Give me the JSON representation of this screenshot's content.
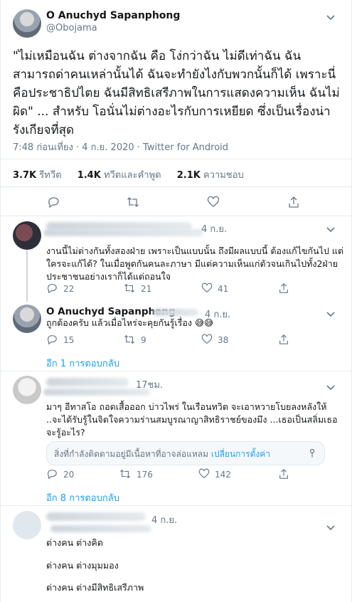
{
  "tweet": {
    "author_name": "O Anuchyd Sapanphong",
    "author_handle": "@Obojama",
    "text": "\"ไม่เหมือนฉัน ต่างจากฉัน คือ โง่กว่าฉัน ไม่ดีเท่าฉัน ฉันสามารถด่าคนเหล่านั้นได้ ฉันจะทำยังไงกับพวกนั้นก็ได้ เพราะนี่คือประชาธิปไตย ฉันมีสิทธิเสรีภาพในการแสดงความเห็น ฉันไม่ผิด\" ... สำหรับ โอนั่นไม่ต่างอะไรกับการเหยียด ซึ่งเป็นเรื่องน่ารังเกียจที่สุด",
    "meta": "7:48 ก่อนเที่ยง · 4 ก.ย. 2020 · Twitter for Android",
    "stats": {
      "retweets_value": "3.7K",
      "retweets_label": "รีทวีต",
      "quotes_value": "1.4K",
      "quotes_label": "ทวีตและคำพูด",
      "likes_value": "2.1K",
      "likes_label": "ความชอบ"
    }
  },
  "replies": [
    {
      "time": "4 ก.ย.",
      "text": "งานนี้ไม่ต่างกันทั้งสองฝ่าย เพราะเป็นแบบนั้น ถึงมีผลแบบนี้ ต้องแก้ไขกันไป แต่ใครจะแก้ได้? ในเมื่อพูดกันคนละภาษา มีแต่ความเห็นแก่ตัวจนเกินไปทั้ง2ฝ่าย ประชาชนอย่างเราก็ได้แต่ถอนใจ",
      "replies": "22",
      "retweets": "21",
      "likes": "41"
    },
    {
      "author_name": "O Anuchyd Sapanphong",
      "time": "4 ก.ย.",
      "text": "ถูกต้องครับ แล้วเมื่อไหร่จะคุยกันรู้เรื่อง 😅😅",
      "replies": "15",
      "retweets": "9",
      "likes": "38",
      "more": "อีก 1 การตอบกลับ"
    },
    {
      "time": "17ชม.",
      "text": "มาๆ อีทาสโอ ถอดเสื้อออก บ่าวไพร่ ในเรือนทวิต จะเอาหวายโบยลงหลังให้ ..จะได้รับรู้ในจิตใจความร่านสมบูรณาญาสิทธิราชย์ของมึง ...เธอเป็นสลิ่มเธอจะรู้อะไร?",
      "notice_text": "สิ่งที่กำลังติดตามอยู่มีเนื้อหาที่อาจล่อแหลม",
      "notice_link": "เปลี่ยนการตั้งค่า",
      "replies": "20",
      "retweets": "176",
      "likes": "142",
      "more": "อีก 8 การตอบกลับ"
    },
    {
      "time": "4 ก.ย.",
      "lines": [
        "ต่างคน ต่างคิด",
        "ต่างคน ต่างมุมมอง",
        "ต่างคน ต่างมีสิทธิเสรีภาพ"
      ]
    }
  ],
  "colors": {
    "accent": "#1da1f2",
    "muted": "#657786",
    "text": "#14171a",
    "border": "#e6ecf0"
  }
}
